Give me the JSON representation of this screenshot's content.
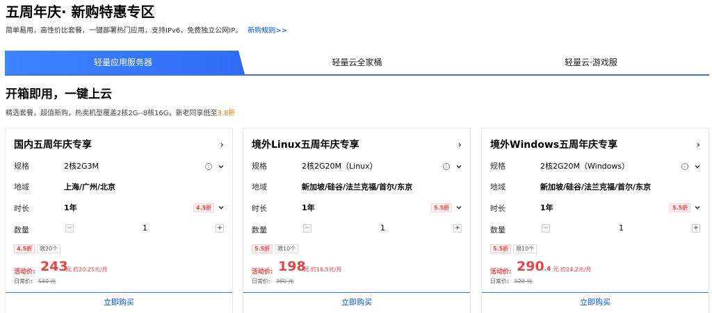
{
  "header": {
    "title": "五周年庆· 新购特惠专区",
    "subtitle": "简单易用，高性价比套餐，一键部署热门应用，支持IPv6，免费独立公网IP。",
    "rules_link": "新购规则>>"
  },
  "tabs": [
    {
      "label": "轻量应用服务器",
      "active": true
    },
    {
      "label": "轻量云全家桶",
      "active": false
    },
    {
      "label": "轻量云·游戏服",
      "active": false
    }
  ],
  "section": {
    "title": "开箱即用，一键上云",
    "subtitle_prefix": "精选套餐，超值新购，热卖机型覆盖2核2G--8核16G，新老同享低至",
    "subtitle_highlight": "3.8折"
  },
  "labels": {
    "spec": "规格",
    "region": "地域",
    "duration": "时长",
    "quantity": "数量",
    "promo_price": "活动价:",
    "regular_price": "日常价:",
    "buy": "立即购买",
    "currency": "元"
  },
  "cards": [
    {
      "title": "国内五周年庆专享",
      "spec": "2核2G3M",
      "region": "上海/广州/北京",
      "duration": "1年",
      "duration_discount": "4.5折",
      "quantity": "1",
      "badge_discount": "4.5折",
      "badge_limit": "限20个",
      "price_int": "243",
      "price_dec": "",
      "monthly": "约20.25元/月",
      "regular": "540 元"
    },
    {
      "title": "境外Linux五周年庆专享",
      "spec": "2核2G20M（Linux）",
      "region": "新加坡/硅谷/法兰克福/首尔/东京",
      "duration": "1年",
      "duration_discount": "5.5折",
      "quantity": "1",
      "badge_discount": "5.5折",
      "badge_limit": "限10个",
      "price_int": "198",
      "price_dec": "",
      "monthly": "约16.5元/月",
      "regular": "360 元"
    },
    {
      "title": "境外Windows五周年庆专享",
      "spec": "2核2G20M（Windows）",
      "region": "新加坡/硅谷/法兰克福/首尔/东京",
      "duration": "1年",
      "duration_discount": "5.5折",
      "quantity": "1",
      "badge_discount": "5.5折",
      "badge_limit": "限10个",
      "price_int": "290",
      "price_dec": ".4",
      "monthly": "约24.2元/月",
      "regular": "528 元"
    }
  ],
  "colors": {
    "accent": "#2e6cf5",
    "price_red": "#e54545",
    "highlight_orange": "#ff7200",
    "link_blue": "#0052d9"
  }
}
